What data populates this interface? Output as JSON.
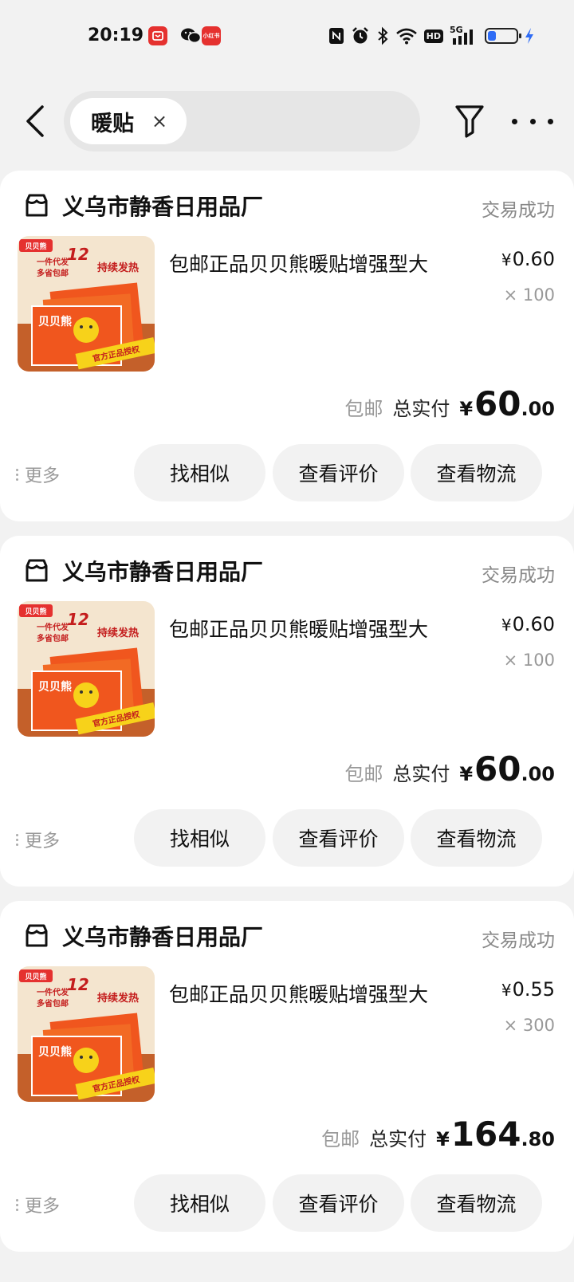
{
  "status_bar": {
    "time": "20:19",
    "notification_icons": [
      "app-notification-icon",
      "wechat-icon",
      "xiaohongshu-icon"
    ],
    "xiaohongshu_label": "小红书",
    "system_icons": [
      "nfc-icon",
      "alarm-icon",
      "bluetooth-icon",
      "wifi-icon",
      "hd-icon",
      "signal-5g-icon",
      "battery-icon",
      "charging-icon"
    ],
    "hd_label": "HD",
    "network_label": "5G",
    "battery_level": 0.3
  },
  "nav": {
    "search_chip": "暖贴",
    "chip_close": "×"
  },
  "orders": [
    {
      "shop": "义乌市静香日用品厂",
      "status": "交易成功",
      "product_title": "包邮正品贝贝熊暖贴增强型大",
      "unit_price_currency": "¥",
      "unit_price": "0.60",
      "quantity": "× 100",
      "shipping": "包邮",
      "total_label": "总实付",
      "total_currency": "¥",
      "total_int": "60",
      "total_dec": ".00",
      "more": "更多",
      "btn_similar": "找相似",
      "btn_review": "查看评价",
      "btn_logistics": "查看物流"
    },
    {
      "shop": "义乌市静香日用品厂",
      "status": "交易成功",
      "product_title": "包邮正品贝贝熊暖贴增强型大",
      "unit_price_currency": "¥",
      "unit_price": "0.60",
      "quantity": "× 100",
      "shipping": "包邮",
      "total_label": "总实付",
      "total_currency": "¥",
      "total_int": "60",
      "total_dec": ".00",
      "more": "更多",
      "btn_similar": "找相似",
      "btn_review": "查看评价",
      "btn_logistics": "查看物流"
    },
    {
      "shop": "义乌市静香日用品厂",
      "status": "交易成功",
      "product_title": "包邮正品贝贝熊暖贴增强型大",
      "unit_price_currency": "¥",
      "unit_price": "0.55",
      "quantity": "× 300",
      "shipping": "包邮",
      "total_label": "总实付",
      "total_currency": "¥",
      "total_int": "164",
      "total_dec": ".80",
      "more": "更多",
      "btn_similar": "找相似",
      "btn_review": "查看评价",
      "btn_logistics": "查看物流"
    }
  ],
  "product_image": {
    "brand": "贝贝熊",
    "tagline_1": "一件代发",
    "tagline_2": "多省包邮",
    "hours": "12",
    "heat_label": "持续发热",
    "pack_label": "贝贝熊",
    "auth_label": "官方正品授权"
  },
  "colors": {
    "accent_red": "#e5312f",
    "battery_blue": "#2f6cf5",
    "image_orange": "#f0561e",
    "image_yellow": "#f7d21a"
  }
}
